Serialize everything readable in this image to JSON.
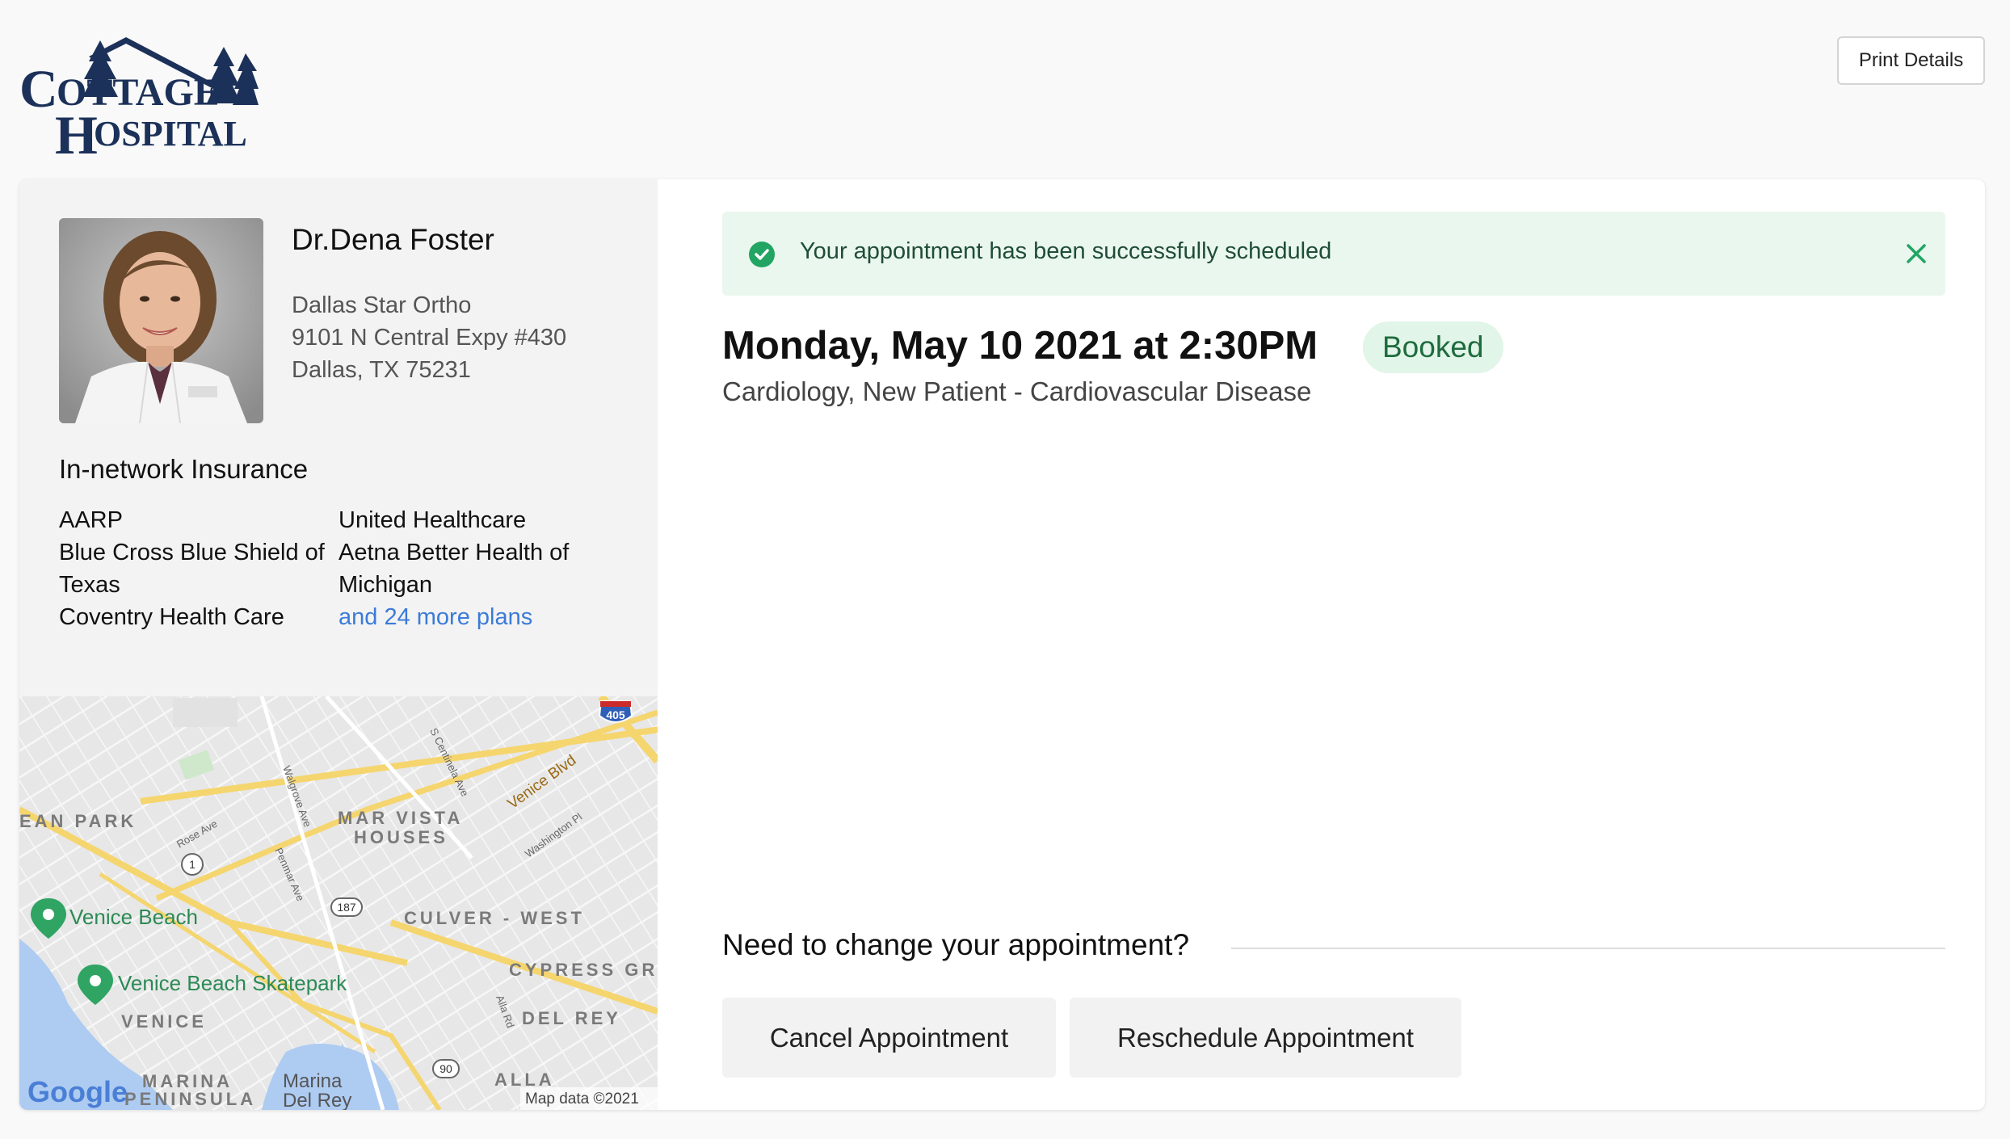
{
  "header": {
    "logo_line1": "COTTAGE",
    "logo_line2": "HOSPITAL",
    "print_label": "Print Details"
  },
  "doctor": {
    "name": "Dr.Dena Foster",
    "address": [
      "Dallas Star Ortho",
      "9101 N Central Expy #430",
      "Dallas, TX 75231"
    ]
  },
  "insurance": {
    "title": "In-network Insurance",
    "col1": [
      "AARP",
      "Blue Cross Blue Shield of Texas",
      "Coventry Health Care"
    ],
    "col2": [
      "United Healthcare",
      "Aetna Better Health of Michigan"
    ],
    "more_link": "and 24 more plans"
  },
  "map": {
    "labels": {
      "ocean_park": "EAN PARK",
      "mar_vista": "MAR VISTA",
      "houses": "HOUSES",
      "culver_west": "CULVER - WEST",
      "cypress": "CYPRESS GRO",
      "venice": "VENICE",
      "del_rey": "DEL REY",
      "marina": "MARINA",
      "peninsula": "PENINSULA",
      "marina_del_rey_1": "Marina",
      "marina_del_rey_2": "Del Rey",
      "alla": "ALLA",
      "venice_beach": "Venice Beach",
      "skatepark": "Venice Beach Skatepark",
      "venice_blvd": "Venice Blvd",
      "rose_ave": "Rose Ave",
      "walgrove": "Walgrove Ave",
      "centinela": "S Centinela Ave",
      "washington": "Washington Pl",
      "penmar": "Penmar Ave",
      "alla_rd": "Alla Rd",
      "shield_405": "405",
      "shield_1": "1",
      "shield_187": "187",
      "shield_90": "90",
      "google": "Google",
      "attribution": "Map data ©2021"
    }
  },
  "alert": {
    "message": "Your appointment has been successfully scheduled",
    "color": "#22a563"
  },
  "appointment": {
    "datetime": "Monday, May 10 2021 at 2:30PM",
    "status": "Booked",
    "visit": "Cardiology, New Patient - Cardiovascular Disease"
  },
  "change": {
    "title": "Need to change your appointment?",
    "cancel_label": "Cancel Appointment",
    "reschedule_label": "Reschedule Appointment"
  }
}
